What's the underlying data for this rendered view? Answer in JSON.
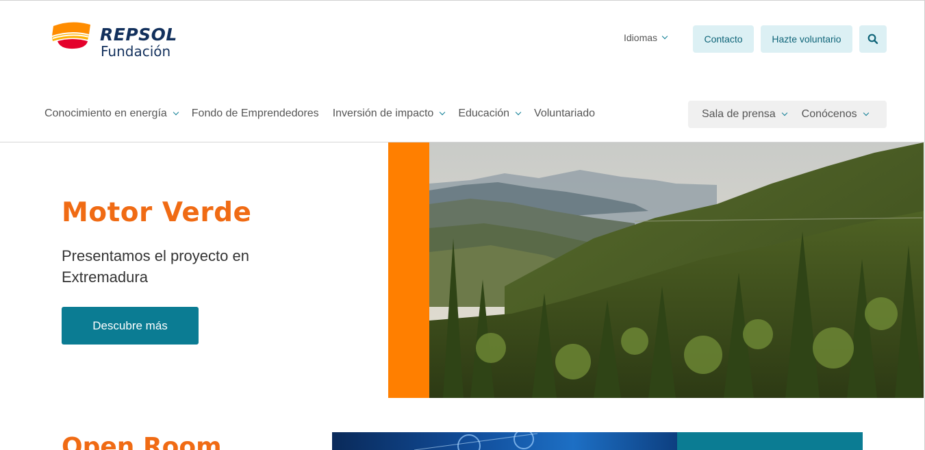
{
  "brand": {
    "wordmark": "REPSOL",
    "subtitle": "Fundación",
    "colors": {
      "orange": "#ff7f00",
      "red": "#e4002b",
      "navy": "#12305c",
      "teal": "#0b7c93"
    }
  },
  "utility": {
    "language_label": "Idiomas",
    "contact_label": "Contacto",
    "volunteer_label": "Hazte voluntario",
    "search_icon": "search-icon"
  },
  "nav": {
    "items": [
      {
        "label": "Conocimiento en energía",
        "has_dropdown": true
      },
      {
        "label": "Fondo de Emprendedores",
        "has_dropdown": false
      },
      {
        "label": "Inversión de impacto",
        "has_dropdown": true
      },
      {
        "label": "Educación",
        "has_dropdown": true
      },
      {
        "label": "Voluntariado",
        "has_dropdown": false
      }
    ],
    "secondary": [
      {
        "label": "Sala de prensa",
        "has_dropdown": true
      },
      {
        "label": "Conócenos",
        "has_dropdown": true
      }
    ]
  },
  "hero": {
    "title": "Motor Verde",
    "subtitle": "Presentamos el proyecto en Extremadura",
    "cta_label": "Descubre más"
  },
  "next_section": {
    "title": "Open Room"
  }
}
